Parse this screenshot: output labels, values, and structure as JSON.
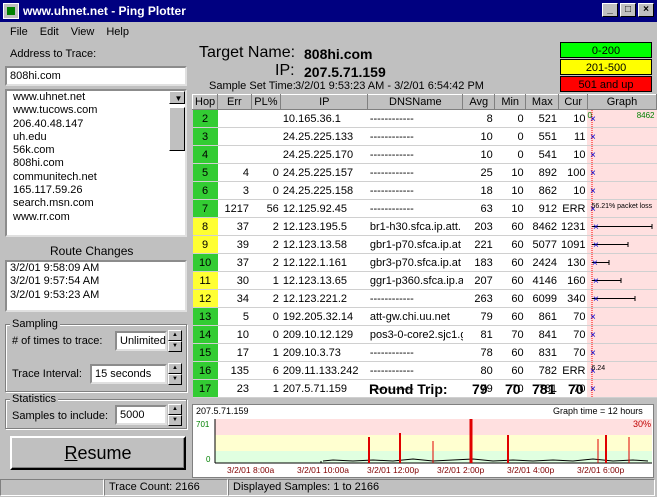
{
  "window": {
    "title": "www.uhnet.net - Ping Plotter",
    "min": "_",
    "max": "□",
    "close": "×"
  },
  "menu": [
    "File",
    "Edit",
    "View",
    "Help"
  ],
  "left": {
    "address_label": "Address to Trace:",
    "address_value": "808hi.com",
    "history": [
      "www.uhnet.net",
      "www.tucows.com",
      "206.40.48.147",
      "uh.edu",
      "56k.com",
      "808hi.com",
      "communitech.net",
      "165.117.59.26",
      "search.msn.com",
      "www.rr.com"
    ],
    "route_changes_label": "Route Changes",
    "route_changes": [
      "3/2/01 9:58:09 AM",
      "3/2/01 9:57:54 AM",
      "3/2/01 9:53:23 AM"
    ],
    "sampling": {
      "title": "Sampling",
      "times_label": "# of times to trace:",
      "times_value": "Unlimited",
      "interval_label": "Trace Interval:",
      "interval_value": "15 seconds"
    },
    "statistics": {
      "title": "Statistics",
      "samples_label": "Samples to include:",
      "samples_value": "5000"
    },
    "resume": "Resume"
  },
  "header": {
    "target_label": "Target Name:",
    "target_value": "808hi.com",
    "ip_label": "IP:",
    "ip_value": "207.5.71.159",
    "sample_label": "Sample Set Time:",
    "sample_value": "3/2/01 9:53:23 AM - 3/2/01 6:54:42 PM",
    "legend": [
      {
        "text": "0-200",
        "color": "#00ff00"
      },
      {
        "text": "201-500",
        "color": "#ffff00"
      },
      {
        "text": "501 and up",
        "color": "#ff0000"
      }
    ]
  },
  "table": {
    "columns": [
      "Hop",
      "Err",
      "PL%",
      "IP",
      "DNSName",
      "Avg",
      "Min",
      "Max",
      "Cur",
      "Graph"
    ],
    "graph_max_label": "8462",
    "graph_zero_label": "0",
    "rows": [
      {
        "hop": "2",
        "err": "",
        "pl": "",
        "ip": "10.165.36.1",
        "dns": "------------",
        "avg": "8",
        "min": "0",
        "max": "521",
        "cur": "10",
        "color": "g",
        "note": "",
        "mark": 0.01
      },
      {
        "hop": "3",
        "err": "",
        "pl": "",
        "ip": "24.25.225.133",
        "dns": "------------",
        "avg": "10",
        "min": "0",
        "max": "551",
        "cur": "11",
        "color": "g",
        "note": "",
        "mark": 0.01
      },
      {
        "hop": "4",
        "err": "",
        "pl": "",
        "ip": "24.25.225.170",
        "dns": "------------",
        "avg": "10",
        "min": "0",
        "max": "541",
        "cur": "10",
        "color": "g",
        "note": "",
        "mark": 0.01
      },
      {
        "hop": "5",
        "err": "4",
        "pl": "0",
        "ip": "24.25.225.157",
        "dns": "------------",
        "avg": "25",
        "min": "10",
        "max": "892",
        "cur": "100",
        "color": "g",
        "note": "",
        "mark": 0.02
      },
      {
        "hop": "6",
        "err": "3",
        "pl": "0",
        "ip": "24.25.225.158",
        "dns": "------------",
        "avg": "18",
        "min": "10",
        "max": "862",
        "cur": "10",
        "color": "g",
        "note": "",
        "mark": 0.01
      },
      {
        "hop": "7",
        "err": "1217",
        "pl": "56",
        "ip": "12.125.92.45",
        "dns": "------------",
        "avg": "63",
        "min": "10",
        "max": "912",
        "cur": "ERR",
        "color": "g",
        "note": "56.21% packet loss",
        "mark": 0.02
      },
      {
        "hop": "8",
        "err": "37",
        "pl": "2",
        "ip": "12.123.195.5",
        "dns": "br1-h30.sfca.ip.att.",
        "avg": "203",
        "min": "60",
        "max": "8462",
        "cur": "1231",
        "color": "y",
        "note": "",
        "mark": 0.06
      },
      {
        "hop": "9",
        "err": "39",
        "pl": "2",
        "ip": "12.123.13.58",
        "dns": "gbr1-p70.sfca.ip.at",
        "avg": "221",
        "min": "60",
        "max": "5077",
        "cur": "1091",
        "color": "y",
        "note": "",
        "mark": 0.06
      },
      {
        "hop": "10",
        "err": "37",
        "pl": "2",
        "ip": "12.122.1.161",
        "dns": "gbr3-p70.sfca.ip.at",
        "avg": "183",
        "min": "60",
        "max": "2424",
        "cur": "130",
        "color": "g",
        "note": "",
        "mark": 0.05
      },
      {
        "hop": "11",
        "err": "30",
        "pl": "1",
        "ip": "12.123.13.65",
        "dns": "ggr1-p360.sfca.ip.a",
        "avg": "207",
        "min": "60",
        "max": "4146",
        "cur": "160",
        "color": "y",
        "note": "",
        "mark": 0.06
      },
      {
        "hop": "12",
        "err": "34",
        "pl": "2",
        "ip": "12.123.221.2",
        "dns": "------------",
        "avg": "263",
        "min": "60",
        "max": "6099",
        "cur": "340",
        "color": "y",
        "note": "",
        "mark": 0.07
      },
      {
        "hop": "13",
        "err": "5",
        "pl": "0",
        "ip": "192.205.32.14",
        "dns": "att-gw.chi.uu.net",
        "avg": "79",
        "min": "60",
        "max": "861",
        "cur": "70",
        "color": "g",
        "note": "",
        "mark": 0.02
      },
      {
        "hop": "14",
        "err": "10",
        "pl": "0",
        "ip": "209.10.12.129",
        "dns": "pos3-0-core2.sjc1.g",
        "avg": "81",
        "min": "70",
        "max": "841",
        "cur": "70",
        "color": "g",
        "note": "",
        "mark": 0.02
      },
      {
        "hop": "15",
        "err": "17",
        "pl": "1",
        "ip": "209.10.3.73",
        "dns": "------------",
        "avg": "78",
        "min": "60",
        "max": "831",
        "cur": "70",
        "color": "g",
        "note": "",
        "mark": 0.02
      },
      {
        "hop": "16",
        "err": "135",
        "pl": "6",
        "ip": "209.11.133.242",
        "dns": "------------",
        "avg": "80",
        "min": "60",
        "max": "782",
        "cur": "ERR",
        "color": "g",
        "note": "6.24",
        "mark": 0.02
      },
      {
        "hop": "17",
        "err": "23",
        "pl": "1",
        "ip": "207.5.71.159",
        "dns": "------------",
        "avg": "79",
        "min": "70",
        "max": "781",
        "cur": "70",
        "color": "g",
        "note": "",
        "mark": 0.02
      }
    ],
    "round_trip_label": "Round Trip:",
    "round_trip": {
      "avg": "79",
      "min": "70",
      "max": "781",
      "cur": "70"
    }
  },
  "timegraph": {
    "host": "207.5.71.159",
    "graph_time": "Graph time = 12 hours",
    "ymax": "701",
    "ymin": "0",
    "loss": "30%",
    "ticks": [
      "3/2/01 8:00a",
      "3/2/01 10:00a",
      "3/2/01 12:00p",
      "3/2/01 2:00p",
      "3/2/01 4:00p",
      "3/2/01 6:00p"
    ]
  },
  "status": {
    "left": "",
    "trace_count": "Trace Count: 2166",
    "displayed": "Displayed Samples: 1 to 2166"
  }
}
